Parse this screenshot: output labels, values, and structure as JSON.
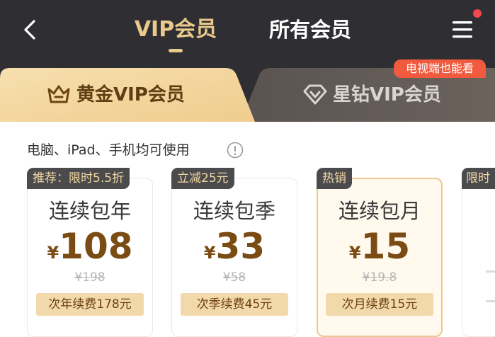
{
  "header": {
    "tab_vip": "VIP会员",
    "tab_all": "所有会员"
  },
  "member_tabs": {
    "gold": "黄金VIP会员",
    "diamond": "星钻VIP会员",
    "tv_badge": "电视端也能看"
  },
  "devices_note": "电脑、iPad、手机均可使用",
  "plans": [
    {
      "badge": "推荐：限时5.5折",
      "name": "连续包年",
      "currency": "¥",
      "price": "108",
      "original": "¥198",
      "renew": "次年续费178元"
    },
    {
      "badge": "立减25元",
      "name": "连续包季",
      "currency": "¥",
      "price": "33",
      "original": "¥58",
      "renew": "次季续费45元"
    },
    {
      "badge": "热销",
      "name": "连续包月",
      "currency": "¥",
      "price": "15",
      "original": "¥19.8",
      "renew": "次月续费15元"
    }
  ],
  "peek_badge": "限时",
  "colors": {
    "header_bg": "#2f2e33",
    "gold_accent": "#e9c98c",
    "price_brown": "#7a4c13",
    "badge_bg": "#4b4b4e",
    "renew_bg": "#f1d9ac",
    "tv_badge_bg": "#f05a3e"
  },
  "icons": {
    "back": "chevron-left",
    "menu": "hamburger",
    "gold": "crown",
    "diamond": "diamond",
    "info": "info-circle"
  }
}
